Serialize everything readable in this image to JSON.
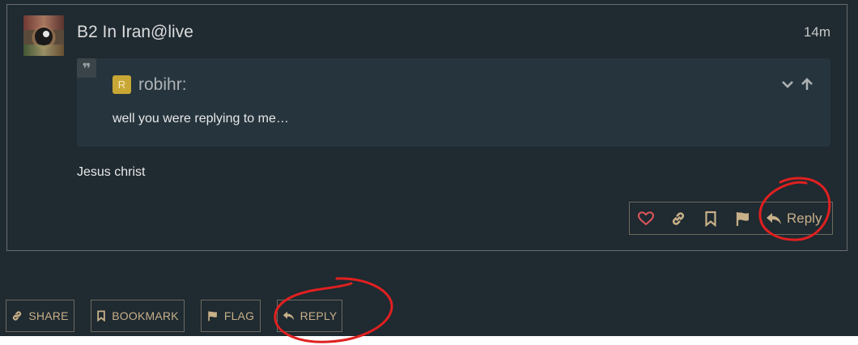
{
  "post": {
    "username": "B2 In Iran@live",
    "time": "14m",
    "quote": {
      "avatar_letter": "R",
      "author": "robihr:",
      "text": "well you were replying to me…"
    },
    "body": "Jesus christ",
    "actions": {
      "reply_label": "Reply"
    }
  },
  "bottom_actions": {
    "share": "SHARE",
    "bookmark": "BOOKMARK",
    "flag": "FLAG",
    "reply": "REPLY"
  },
  "colors": {
    "background": "#1f2a31",
    "quote_background": "#26343d",
    "accent": "#c8b089",
    "like": "#e0575b",
    "annotation": "#e02020"
  },
  "icons": [
    "heart-icon",
    "link-icon",
    "bookmark-icon",
    "flag-icon",
    "reply-icon",
    "chevron-down-icon",
    "arrow-up-icon",
    "quote-icon"
  ]
}
